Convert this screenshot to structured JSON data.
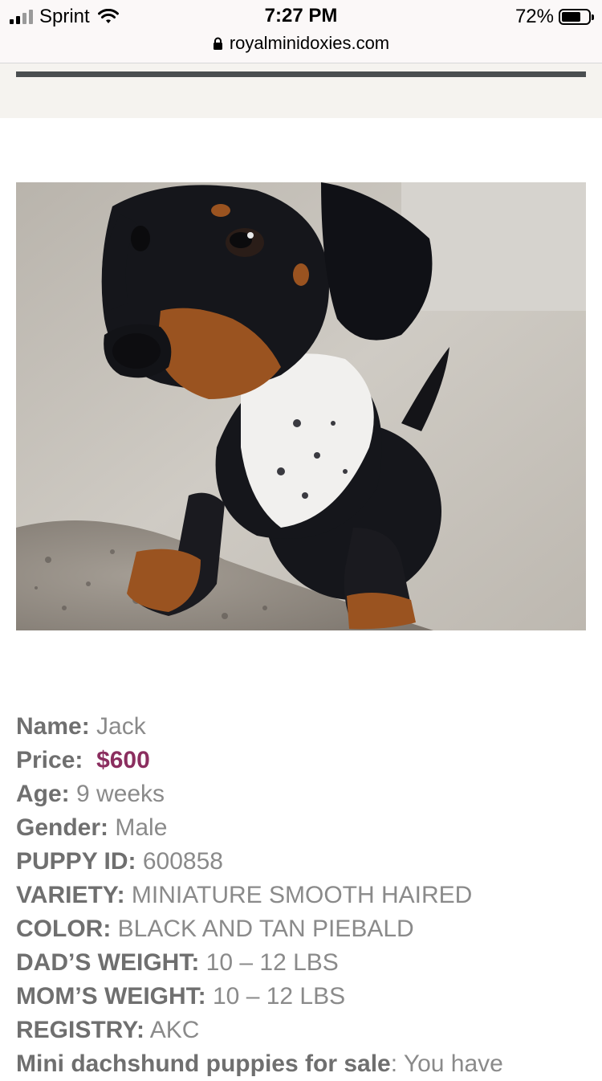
{
  "status_bar": {
    "carrier": "Sprint",
    "time": "7:27 PM",
    "battery_percent": "72%",
    "battery_level": 0.72
  },
  "browser": {
    "url": "royalminidoxies.com"
  },
  "photo": {
    "subject": "black and tan piebald miniature dachshund puppy"
  },
  "details": [
    {
      "label": "Name:",
      "value": " Jack"
    },
    {
      "label": "Price:",
      "value": "$600"
    },
    {
      "label": "Age:",
      "value": " 9 weeks"
    },
    {
      "label": "Gender:",
      "value": " Male"
    },
    {
      "label": "PUPPY ID:",
      "value": " 600858"
    },
    {
      "label": "VARIETY:",
      "value": " MINIATURE SMOOTH HAIRED"
    },
    {
      "label": "COLOR:",
      "value": " BLACK AND TAN PIEBALD"
    },
    {
      "label": "DAD’S WEIGHT:",
      "value": " 10 – 12 LBS"
    },
    {
      "label": "MOM’S WEIGHT:",
      "value": " 10 – 12 LBS"
    },
    {
      "label": "REGISTRY:",
      "value": " AKC"
    },
    {
      "label": "Mini dachshund puppies for sale",
      "value": ": You have"
    }
  ],
  "colors": {
    "price": "#8b2e5f",
    "label": "#6f6f6f",
    "value": "#8a8a8a",
    "bar": "#4a4e50"
  }
}
